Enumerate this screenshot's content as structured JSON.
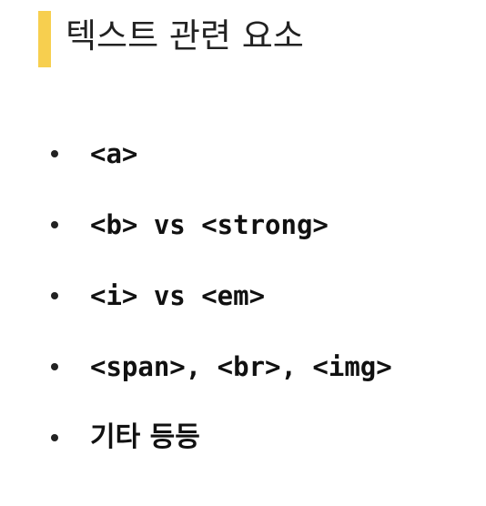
{
  "header": {
    "title": "텍스트 관련 요소"
  },
  "list": {
    "items": [
      {
        "label": "<a>"
      },
      {
        "label": "<b> vs <strong>"
      },
      {
        "label": "<i> vs <em>"
      },
      {
        "label": "<span>, <br>, <img>"
      },
      {
        "label": "기타 등등"
      }
    ]
  },
  "colors": {
    "accent": "#f7cf4f",
    "text": "#222222",
    "background": "#ffffff"
  }
}
